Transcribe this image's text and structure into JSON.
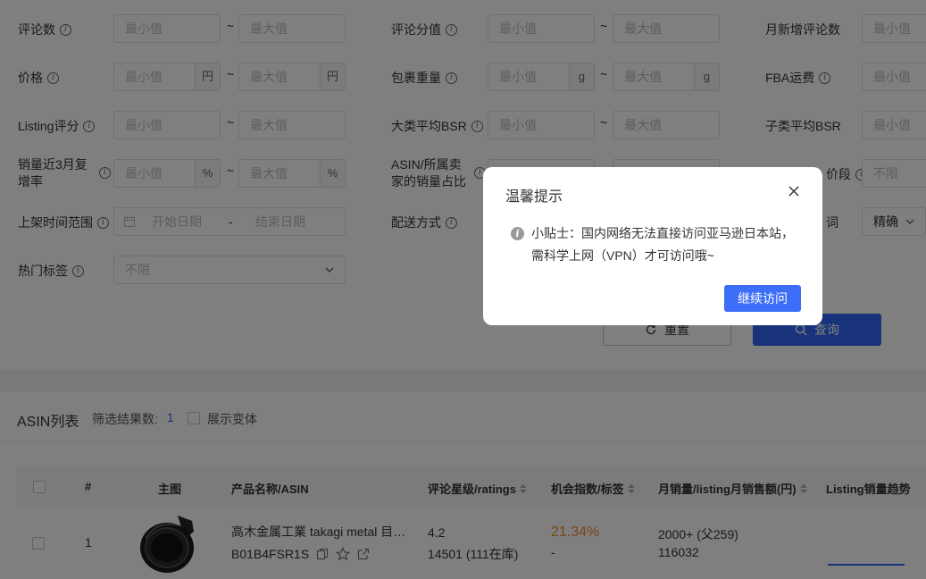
{
  "filters": {
    "placeholder_min": "最小值",
    "placeholder_max": "最大值",
    "tilde": "~",
    "review_count": "评论数",
    "review_score": "评论分值",
    "monthly_new_reviews": "月新增评论数",
    "price": "价格",
    "unit_yen": "円",
    "package_weight": "包裹重量",
    "unit_g": "g",
    "fba_fee": "FBA运费",
    "listing_rating": "Listing评分",
    "category_avg_bsr": "大类平均BSR",
    "subcategory_avg_bsr": "子类平均BSR",
    "sales_growth_3m": "销量近3月复增率",
    "unit_percent": "%",
    "asin_sales_share": "ASIN/所属卖家的销量占比",
    "price_band_suffix": "价段",
    "unlimited": "不限",
    "listing_time_range": "上架时间范围",
    "start_date": "开始日期",
    "date_sep": "-",
    "end_date": "结束日期",
    "delivery_method": "配送方式",
    "match_suffix": "词",
    "match_mode": "精确",
    "hot_tags": "热门标签",
    "hot_tags_value": "不限",
    "reset_button": "重置",
    "query_button": "查询"
  },
  "list": {
    "title": "ASIN列表",
    "result_label": "筛选结果数:",
    "result_count": "1",
    "show_variants": "展示变体",
    "columns": {
      "index": "#",
      "image": "主图",
      "product_name": "产品名称/ASIN",
      "rating": "评论星级/ratings",
      "opportunity": "机会指数/标签",
      "monthly_sales": "月销量/listing月销售额(円)",
      "sales_trend": "Listing销量趋势"
    },
    "rows": [
      {
        "index": "1",
        "product_name": "高木金属工業 takagi metal 目…",
        "asin": "B01B4FSR1S",
        "rating": "4.2",
        "ratings_count": "14501 (111在库)",
        "opportunity": "21.34%",
        "opportunity_tag": "-",
        "monthly_sales": "2000+ (父259)",
        "monthly_revenue": "116032"
      }
    ]
  },
  "dialog": {
    "title": "温馨提示",
    "line1": "小贴士：国内网络无法直接访问亚马逊日本站，",
    "line2": "需科学上网（VPN）才可访问哦~",
    "continue_button": "继续访问"
  },
  "colors": {
    "accent": "#3167f5",
    "opportunity": "#f08c28",
    "overlay": "rgba(0,0,0,0.5)"
  }
}
